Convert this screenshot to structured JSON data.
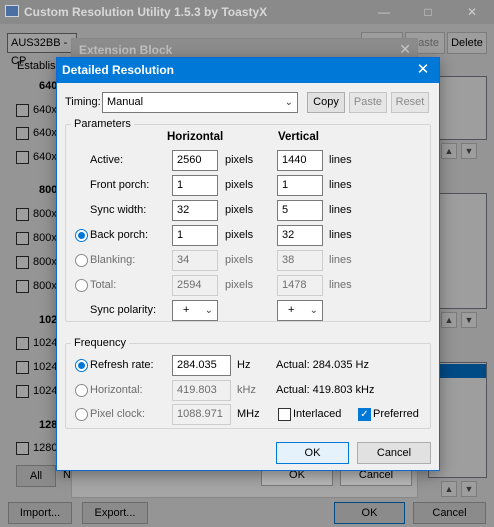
{
  "main": {
    "title": "Custom Resolution Utility 1.5.3 by ToastyX",
    "monitor_combo": "AUS32BB - CP",
    "paste_label": "Paste",
    "delete_label": "Delete",
    "established_label": "Establish",
    "sec_640": "640",
    "items_640": [
      "640x",
      "640x",
      "640x"
    ],
    "sec_800": "800",
    "items_800": [
      "800x",
      "800x",
      "800x",
      "800x"
    ],
    "sec_1024": "102",
    "items_1024": [
      "1024",
      "1024",
      "1024"
    ],
    "sec_1280": "128",
    "items_1280": [
      "1280"
    ],
    "all_label": "All",
    "n_label": "N",
    "import_label": "Import...",
    "export_label": "Export...",
    "ok_label": "OK",
    "cancel_label": "Cancel",
    "min_icon": "minimize-icon",
    "close_icon": "close-icon"
  },
  "extension": {
    "title": "Extension Block",
    "ok_label": "OK",
    "cancel_label": "Cancel"
  },
  "dialog": {
    "title": "Detailed Resolution",
    "timing_label": "Timing:",
    "timing_value": "Manual",
    "copy_label": "Copy",
    "paste_label": "Paste",
    "reset_label": "Reset",
    "parameters_label": "Parameters",
    "horizontal_header": "Horizontal",
    "vertical_header": "Vertical",
    "rows": [
      {
        "label": "Active:",
        "h": "2560",
        "h_unit": "pixels",
        "v": "1440",
        "v_unit": "lines"
      },
      {
        "label": "Front porch:",
        "h": "1",
        "h_unit": "pixels",
        "v": "1",
        "v_unit": "lines"
      },
      {
        "label": "Sync width:",
        "h": "32",
        "h_unit": "pixels",
        "v": "5",
        "v_unit": "lines"
      },
      {
        "label": "Back porch:",
        "h": "1",
        "h_unit": "pixels",
        "v": "32",
        "v_unit": "lines"
      },
      {
        "label": "Blanking:",
        "h": "34",
        "h_unit": "pixels",
        "v": "38",
        "v_unit": "lines"
      },
      {
        "label": "Total:",
        "h": "2594",
        "h_unit": "pixels",
        "v": "1478",
        "v_unit": "lines"
      }
    ],
    "sync_polarity_label": "Sync polarity:",
    "h_polarity": "+",
    "v_polarity": "+",
    "frequency_label": "Frequency",
    "refresh_label": "Refresh rate:",
    "refresh_value": "284.035",
    "refresh_unit": "Hz",
    "refresh_actual": "Actual: 284.035 Hz",
    "horizontal_label": "Horizontal:",
    "horizontal_value": "419.803",
    "horizontal_unit": "kHz",
    "horizontal_actual": "Actual: 419.803 kHz",
    "pixel_clock_label": "Pixel clock:",
    "pixel_clock_value": "1088.971",
    "pixel_clock_unit": "MHz",
    "interlaced_label": "Interlaced",
    "interlaced_checked": false,
    "preferred_label": "Preferred",
    "preferred_checked": true,
    "ok_label": "OK",
    "cancel_label": "Cancel",
    "close_icon": "close-icon",
    "accent_color": "#0078d7"
  }
}
